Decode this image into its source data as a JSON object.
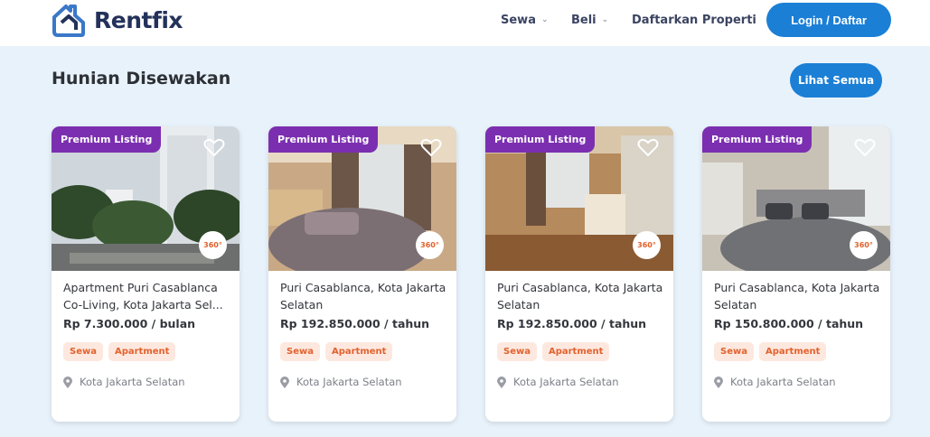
{
  "brand": {
    "name": "Rentfix",
    "color": "#1b7fd6"
  },
  "nav": {
    "sewa": "Sewa",
    "beli": "Beli",
    "daftarkan": "Daftarkan Properti",
    "login": "Login / Daftar"
  },
  "section": {
    "title": "Hunian Disewakan",
    "see_all": "Lihat Semua"
  },
  "listings": [
    {
      "badge": "Premium Listing",
      "title": "Apartment Puri Casablanca Co-Living, Kota Jakarta Sel...",
      "price": "Rp 7.300.000 / bulan",
      "tags": [
        "Sewa",
        "Apartment"
      ],
      "location": "Kota Jakarta Selatan",
      "image_name": "building-exterior-image"
    },
    {
      "badge": "Premium Listing",
      "title": "Puri Casablanca, Kota Jakarta Selatan",
      "price": "Rp 192.850.000 / tahun",
      "tags": [
        "Sewa",
        "Apartment"
      ],
      "location": "Kota Jakarta Selatan",
      "image_name": "bedroom-image"
    },
    {
      "badge": "Premium Listing",
      "title": "Puri Casablanca, Kota Jakarta Selatan",
      "price": "Rp 192.850.000 / tahun",
      "tags": [
        "Sewa",
        "Apartment"
      ],
      "location": "Kota Jakarta Selatan",
      "image_name": "wardrobe-room-image"
    },
    {
      "badge": "Premium Listing",
      "title": "Puri Casablanca, Kota Jakarta Selatan",
      "price": "Rp 150.800.000 / tahun",
      "tags": [
        "Sewa",
        "Apartment"
      ],
      "location": "Kota Jakarta Selatan",
      "image_name": "bedroom-grey-image"
    }
  ],
  "icons": {
    "favorite": "heart-icon",
    "tour": "360-view-icon",
    "location": "location-pin-icon",
    "dropdown": "chevron-down-icon"
  },
  "colors": {
    "badge": "#7b2fb0",
    "tag_bg": "#fde8df",
    "tag_text": "#e2622e",
    "page_bg": "#e8f2fb"
  }
}
